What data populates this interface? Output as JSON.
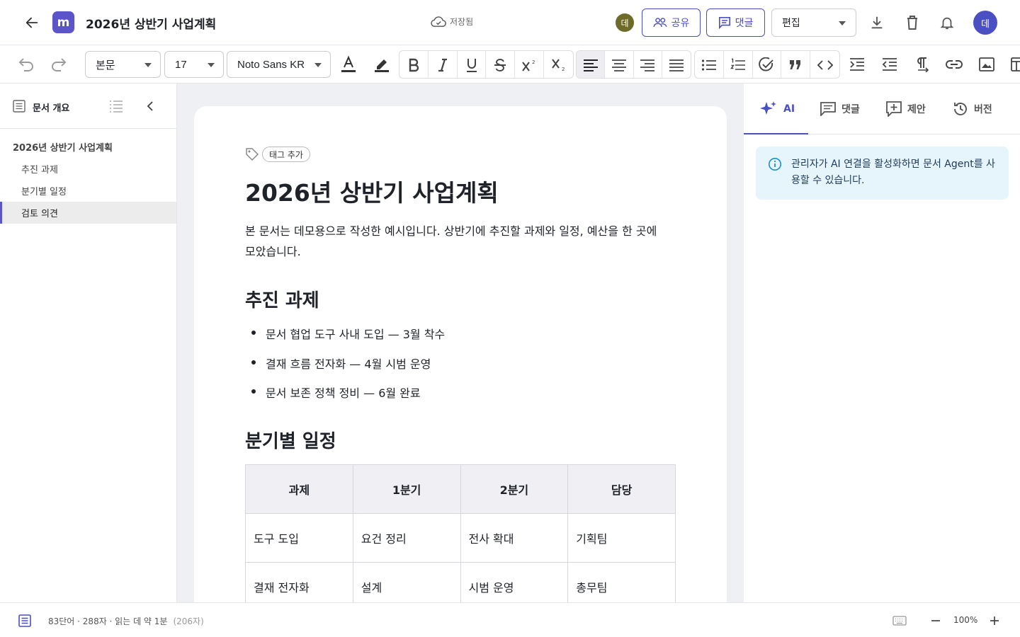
{
  "header": {
    "logo_letter": "m",
    "title": "2026년 상반기 사업계획",
    "saved_status": "저장됨",
    "collaborator_initial": "데",
    "share_label": "공유",
    "comment_label": "댓글",
    "mode_value": "편집",
    "user_initial": "데"
  },
  "toolbar": {
    "style_value": "본문",
    "size_value": "17",
    "font_value": "Noto Sans KR",
    "superscript_mark": "2",
    "subscript_mark": "2"
  },
  "sidebar": {
    "title": "문서 개요",
    "items": [
      {
        "label": "2026년 상반기 사업계획",
        "level": 1
      },
      {
        "label": "추진 과제",
        "level": 2
      },
      {
        "label": "분기별 일정",
        "level": 2
      },
      {
        "label": "검토 의견",
        "level": 2,
        "active": true
      }
    ]
  },
  "document": {
    "tag_add": "태그 추가",
    "title": "2026년 상반기 사업계획",
    "intro": "본 문서는 데모용으로 작성한 예시입니다. 상반기에 추진할 과제와 일정, 예산을 한 곳에 모았습니다.",
    "section1_heading": "추진 과제",
    "bullets": [
      "문서 협업 도구 사내 도입 — 3월 착수",
      "결재 흐름 전자화 — 4월 시범 운영",
      "문서 보존 정책 정비 — 6월 완료"
    ],
    "section2_heading": "분기별 일정",
    "table": {
      "headers": [
        "과제",
        "1분기",
        "2분기",
        "담당"
      ],
      "rows": [
        [
          "도구 도입",
          "요건 정리",
          "전사 확대",
          "기획팀"
        ],
        [
          "결재 전자화",
          "설계",
          "시범 운영",
          "총무팀"
        ]
      ]
    }
  },
  "right_panel": {
    "tabs": [
      "AI",
      "댓글",
      "제안",
      "버전"
    ],
    "info_message": "관리자가 AI 연결을 활성화하면 문서 Agent를 사용할 수 있습니다."
  },
  "status_bar": {
    "stats": "83단어 · 288자 · 읽는 데 약 1분",
    "char_count_extra": "(206자)",
    "zoom": "100%"
  },
  "colors": {
    "accent": "#4b4fc4",
    "logo": "#5c55c9",
    "info_bg": "#e6f4fb"
  }
}
